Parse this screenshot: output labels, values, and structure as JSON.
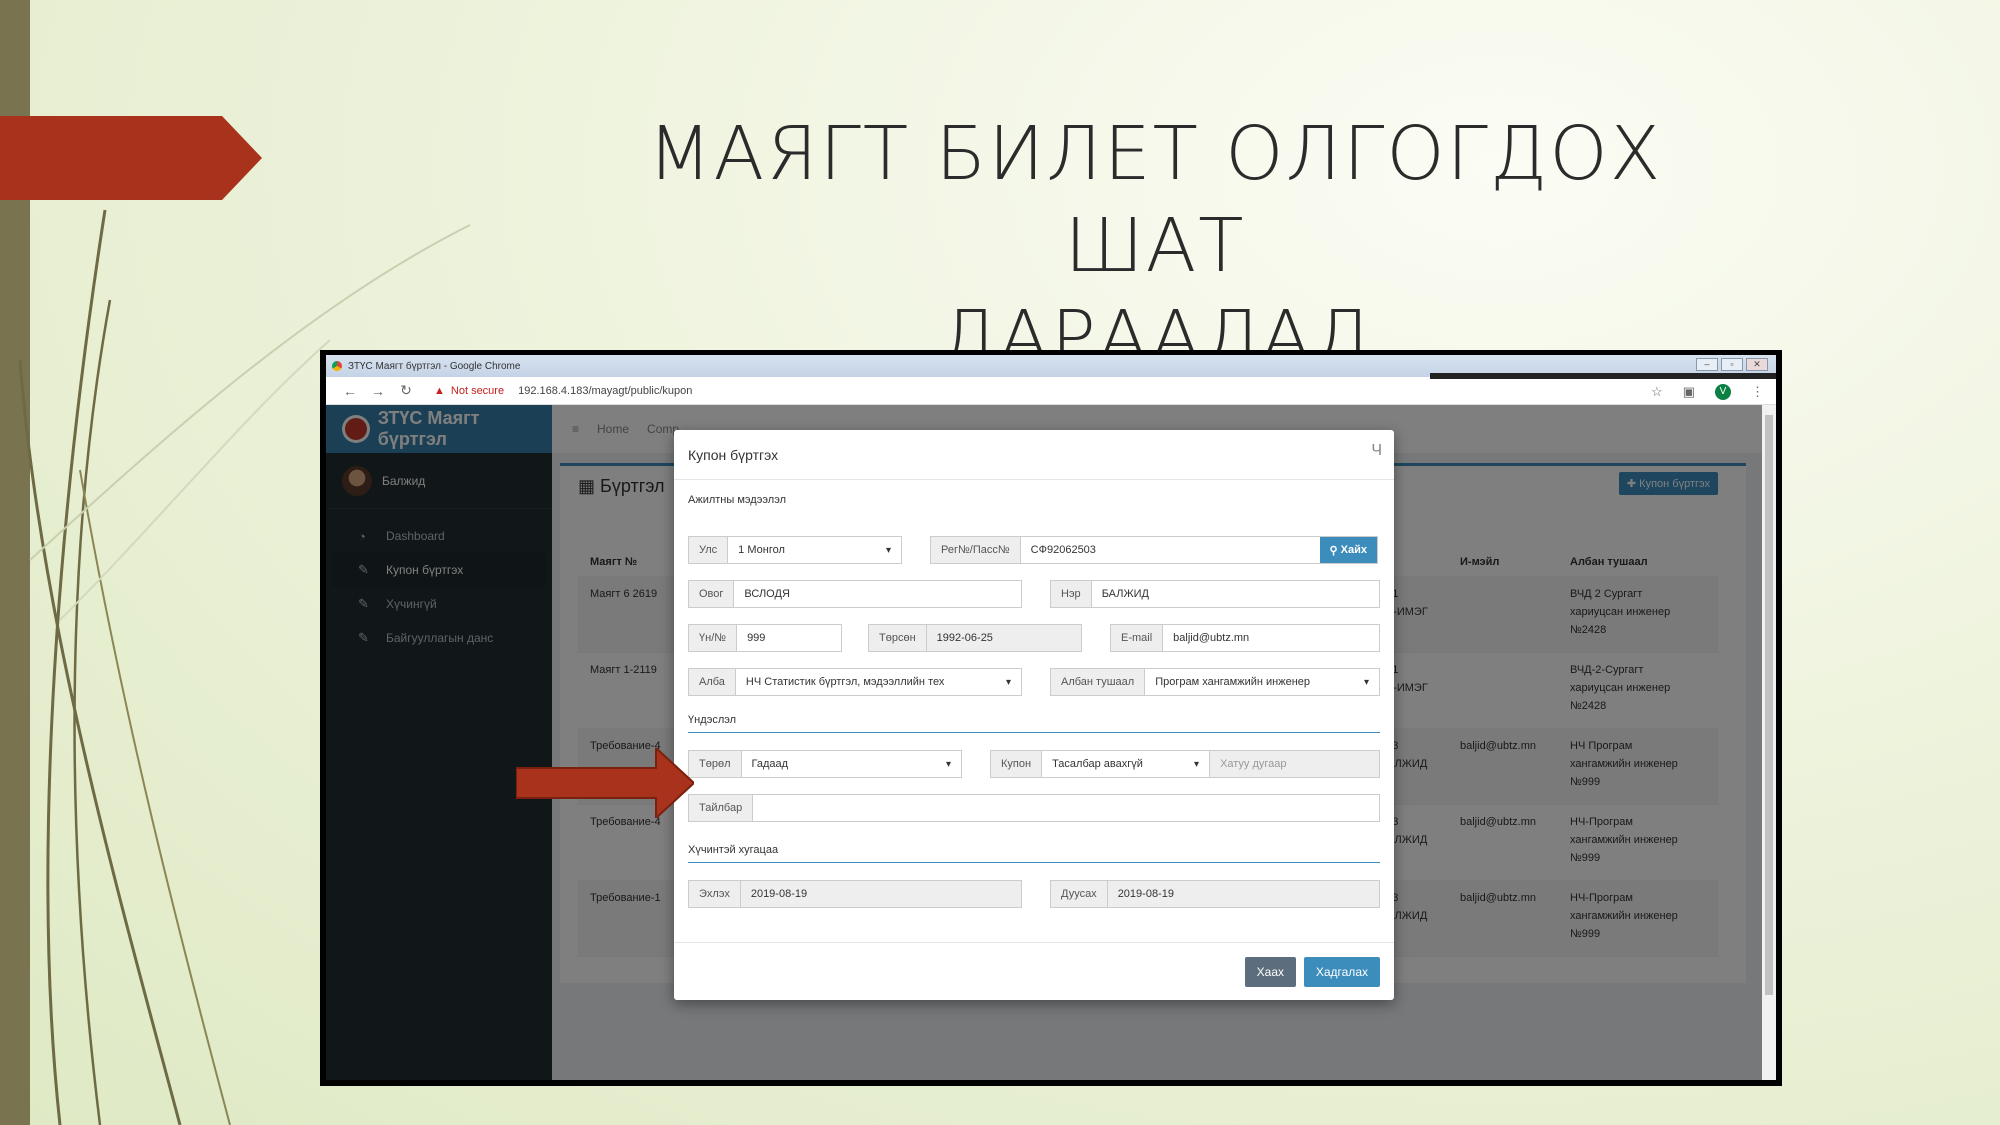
{
  "slide": {
    "title_line1": "МАЯГТ БИЛЕТ ОЛГОГДОХ ШАТ",
    "title_line2": "ДАРААЛАЛ",
    "colors": {
      "ribbon": "#a8321c",
      "leftbar": "#7a7350",
      "arrow": "#a8321c"
    }
  },
  "browser": {
    "window_title": "ЗТҮС Маягт бүртгэл - Google Chrome",
    "not_secure": "Not secure",
    "url": "192.168.4.183/mayagt/public/kupon",
    "profile_initial": "V"
  },
  "app": {
    "brand": "ЗТҮС Маягт бүртгэл",
    "user": "Балжид",
    "menu": [
      {
        "label": "Dashboard",
        "icon": "dashboard-icon"
      },
      {
        "label": "Купон бүртгэх",
        "icon": "ticket-icon"
      },
      {
        "label": "Хүчингүй",
        "icon": "ticket-icon"
      },
      {
        "label": "Байгууллагын данс",
        "icon": "ticket-icon"
      }
    ],
    "breadcrumb": [
      "Home",
      "Comp..."
    ],
    "box_title": "Бүртгэл",
    "add_button": "✚ Купон бүртгэх",
    "table": {
      "headers": [
        "Маягт №",
        "",
        "",
        "И-мэйл",
        "Албан тушаал"
      ],
      "rows": [
        {
          "c1": "Маягт 6 2619",
          "c3": "751\nАТ-ИМЭГ",
          "c4": "",
          "c5": "ВЧД 2 Сургагт\nхариуцсан инженер\n№2428"
        },
        {
          "c1": "Маягт 1-2119",
          "c3": "781\nАТ-ИМЭГ",
          "c4": "",
          "c5": "ВЧД-2-Сургагт\nхариуцсан инженер\n№2428"
        },
        {
          "c1": "Требование-4",
          "c3": "503\nБАЛЖИД",
          "c4": "baljid@ubtz.mn",
          "c5": "НЧ Програм\nхангамжийн инженер\n№999"
        },
        {
          "c1": "Требование-4",
          "c3": "503\nБАЛЖИД",
          "c4": "baljid@ubtz.mn",
          "c5": "НЧ-Програм\nхангамжийн инженер\n№999"
        },
        {
          "c1": "Требование-1",
          "c3": "503\nБАЛЖИД",
          "c4": "baljid@ubtz.mn",
          "c5": "НЧ-Програм\nхангамжийн инженер\n№999"
        }
      ]
    }
  },
  "modal": {
    "title": "Купон бүртгэх",
    "close": "Ч",
    "section_employee": "Ажилтны мэдээлэл",
    "country_label": "Улс",
    "country_value": "1 Монгол",
    "reg_label": "Рег№/Пасс№",
    "reg_value": "СФ92062503",
    "search_button": "Хайх",
    "surname_label": "Овог",
    "surname_value": "ВСЛОДЯ",
    "name_label": "Нэр",
    "name_value": "БАЛЖИД",
    "id_label": "Үн/№",
    "id_value": "999",
    "birth_label": "Төрсөн",
    "birth_value": "1992-06-25",
    "email_label": "E-mail",
    "email_value": "baljid@ubtz.mn",
    "dept_label": "Алба",
    "dept_value": "НЧ Статистик бүртгэл, мэдээллийн тех",
    "position_label": "Албан тушаал",
    "position_value": "Програм хангамжийн инженер",
    "section_basis": "Үндэслэл",
    "type_label": "Төрөл",
    "type_value": "Гадаад",
    "coupon_label": "Купон",
    "coupon_value": "Тасалбар авахгүй",
    "coupon_number_placeholder": "Хатуу дугаар",
    "note_label": "Тайлбар",
    "section_validity": "Хүчинтэй хугацаа",
    "start_label": "Эхлэх",
    "start_value": "2019-08-19",
    "end_label": "Дуусах",
    "end_value": "2019-08-19",
    "close_button": "Хаах",
    "save_button": "Хадгалах"
  }
}
